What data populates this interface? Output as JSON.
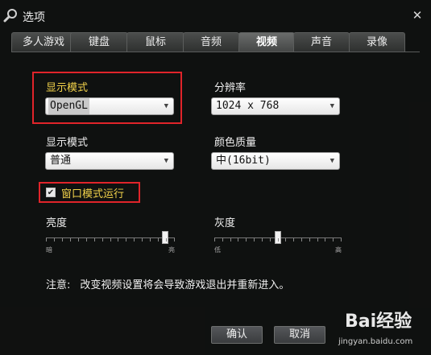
{
  "window": {
    "title": "选项",
    "close_glyph": "✕"
  },
  "tabs": [
    {
      "label": "多人游戏",
      "active": false
    },
    {
      "label": "键盘",
      "active": false
    },
    {
      "label": "鼠标",
      "active": false
    },
    {
      "label": "音频",
      "active": false
    },
    {
      "label": "视频",
      "active": true
    },
    {
      "label": "声音",
      "active": false
    },
    {
      "label": "录像",
      "active": false
    }
  ],
  "video": {
    "display_mode_label": "显示模式",
    "display_mode_value": "OpenGL",
    "resolution_label": "分辨率",
    "resolution_value": "1024 x 768",
    "display_mode2_label": "显示模式",
    "display_mode2_value": "普通",
    "color_quality_label": "颜色质量",
    "color_quality_value": "中(16bit)",
    "windowed_label": "窗口模式运行",
    "windowed_checked": true,
    "brightness_label": "亮度",
    "brightness_min": "暗",
    "brightness_max": "亮",
    "brightness_level": 0.95,
    "gamma_label": "灰度",
    "gamma_min": "低",
    "gamma_max": "高",
    "gamma_level": 0.5
  },
  "notice": {
    "prefix": "注意:",
    "text": "改变视频设置将会导致游戏退出并重新进入。"
  },
  "buttons": {
    "ok": "确认",
    "cancel": "取消"
  },
  "watermark": {
    "logo": "Bai经验",
    "url": "jingyan.baidu.com"
  },
  "colors": {
    "highlight": "#e0242a",
    "accent_label": "#f2d24a"
  }
}
